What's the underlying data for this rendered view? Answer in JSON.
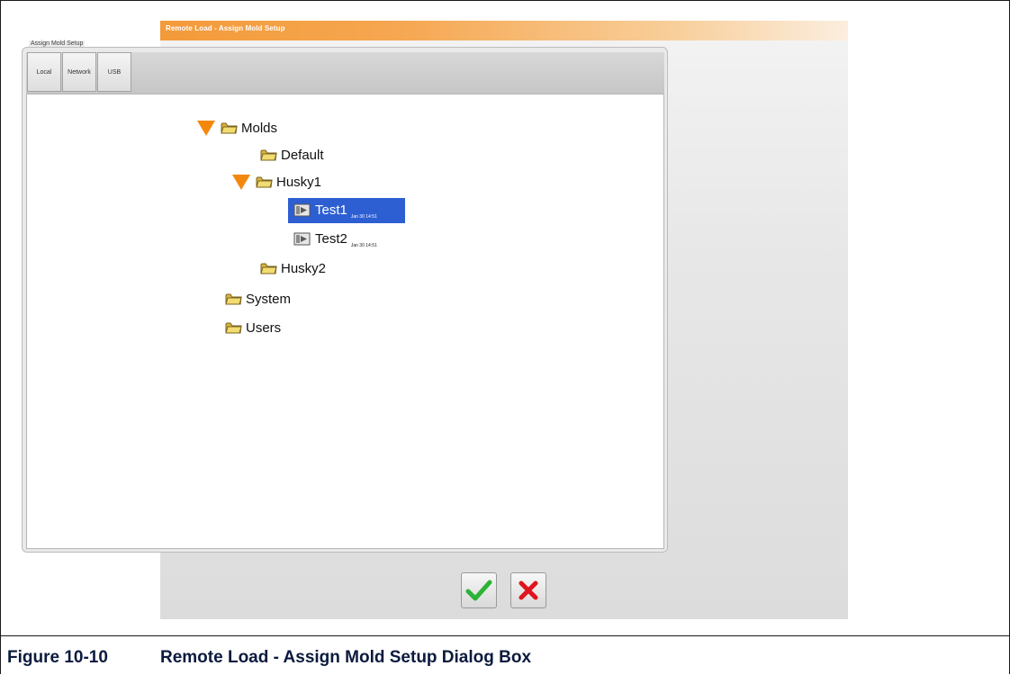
{
  "dialog": {
    "title": "Remote Load - Assign Mold Setup",
    "group_label": "Assign Mold Setup",
    "tabs": [
      {
        "label": "Local"
      },
      {
        "label": "Network"
      },
      {
        "label": "USB"
      }
    ]
  },
  "tree": {
    "molds": "Molds",
    "default": "Default",
    "husky1": "Husky1",
    "test1": {
      "label": "Test1",
      "date": "Jan 30 14:51",
      "selected": true
    },
    "test2": {
      "label": "Test2",
      "date": "Jan 30 14:51",
      "selected": false
    },
    "husky2": "Husky2",
    "system": "System",
    "users": "Users"
  },
  "buttons": {
    "ok_icon": "checkmark-icon",
    "cancel_icon": "x-icon"
  },
  "caption": {
    "number": "Figure 10-10",
    "text": "Remote Load - Assign Mold Setup Dialog Box"
  },
  "colors": {
    "title_bar": "#f39a3a",
    "expander": "#f4880e",
    "selection": "#2d5fd3",
    "ok_green": "#2db336",
    "cancel_red": "#e0141e",
    "caption_text": "#0b1a3e"
  }
}
